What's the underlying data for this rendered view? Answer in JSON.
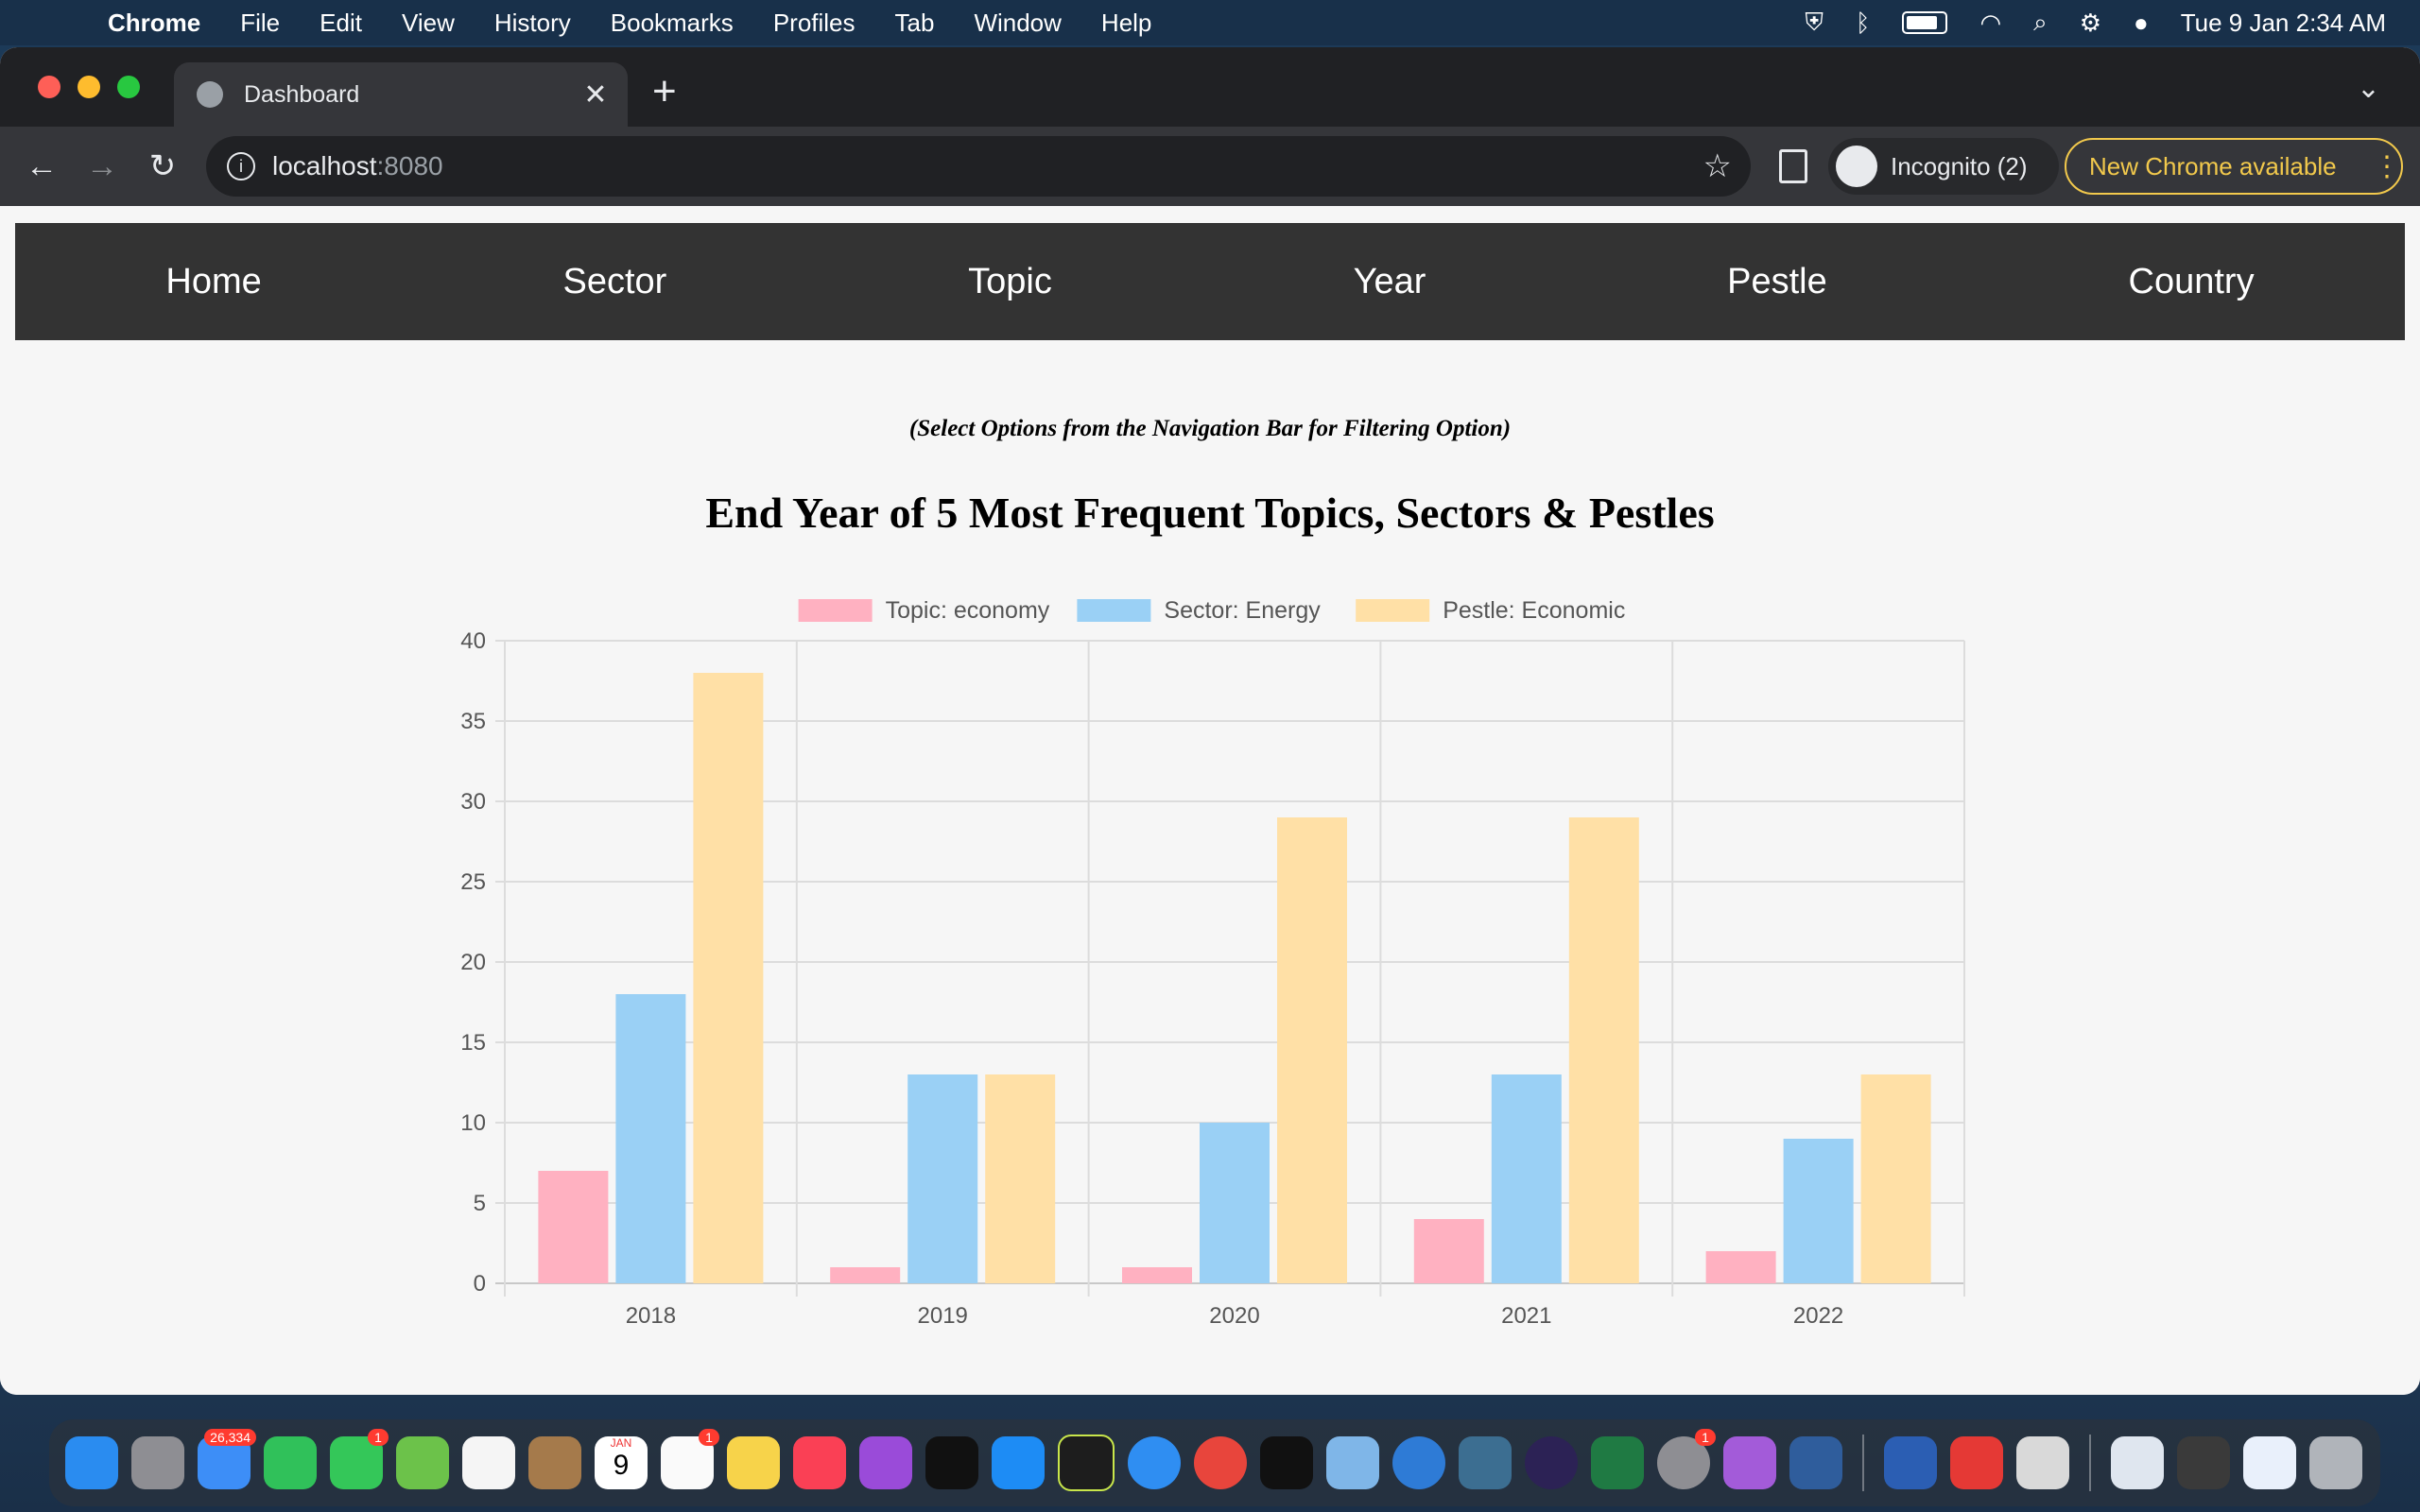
{
  "menubar": {
    "app": "Chrome",
    "items": [
      "File",
      "Edit",
      "View",
      "History",
      "Bookmarks",
      "Profiles",
      "Tab",
      "Window",
      "Help"
    ],
    "datetime": "Tue 9 Jan  2:34 AM"
  },
  "browser": {
    "tab_title": "Dashboard",
    "url_host": "localhost",
    "url_port": ":8080",
    "incognito_label": "Incognito (2)",
    "update_label": "New Chrome available"
  },
  "nav": {
    "items": [
      "Home",
      "Sector",
      "Topic",
      "Year",
      "Pestle",
      "Country"
    ]
  },
  "page": {
    "subtitle": "(Select Options from the Navigation Bar for Filtering Option)",
    "title": "End Year of 5 Most Frequent Topics, Sectors & Pestles"
  },
  "chart_data": {
    "type": "bar",
    "categories": [
      "2018",
      "2019",
      "2020",
      "2021",
      "2022"
    ],
    "series": [
      {
        "name": "Topic: economy",
        "values": [
          7,
          1,
          1,
          4,
          2
        ],
        "color": "#ffb1c1",
        "border": "#ff6384"
      },
      {
        "name": "Sector: Energy",
        "values": [
          18,
          13,
          10,
          13,
          9
        ],
        "color": "#9ad0f5",
        "border": "#36a2eb"
      },
      {
        "name": "Pestle: Economic",
        "values": [
          38,
          13,
          29,
          29,
          13
        ],
        "color": "#ffe0a6",
        "border": "#ffcd56"
      }
    ],
    "ylim": [
      0,
      40
    ],
    "yticks": [
      0,
      5,
      10,
      15,
      20,
      25,
      30,
      35,
      40
    ],
    "grid": true,
    "legend": "top"
  },
  "dock": {
    "mail_badge": "26,334",
    "messages_badge": "1",
    "reminders_badge": "1",
    "settings_badge": "1",
    "calendar_month": "JAN",
    "calendar_day": "9"
  }
}
